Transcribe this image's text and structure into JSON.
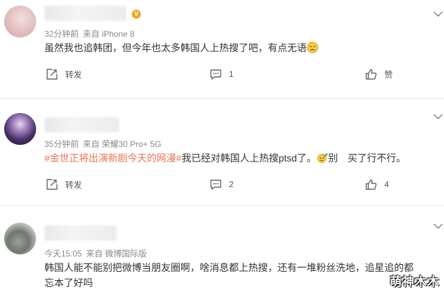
{
  "comments": [
    {
      "meta": {
        "time": "32分钟前",
        "source": "来自 iPhone 8"
      },
      "text": "虽然我也追韩团，但今年也太多韩国人上热搜了吧，有点无语",
      "emoji": "disappointed-face-emoji",
      "actions": {
        "repost_label": "转发",
        "comment_count": "1",
        "like_label": "赞"
      }
    },
    {
      "meta": {
        "time": "35分钟前",
        "source": "来自 荣耀30 Pro+ 5G"
      },
      "hashtag": "#金世正将出演新剧今天的网漫#",
      "text_a": "我已经对韩国人上热搜ptsd了。",
      "emoji": "leaf-face-emoji",
      "text_b": "别　买了行不行。",
      "actions": {
        "repost_label": "转发",
        "comment_count": "2",
        "like_count": "4"
      }
    },
    {
      "meta": {
        "time": "今天15:05",
        "source": "来自 微博国际版"
      },
      "line1": "韩国人能不能别把微博当朋友圈啊，啥消息都上热搜，还有一堆粉丝洗地，追星追的都",
      "line2": "忘本了好吗"
    }
  ],
  "watermark": "萌神木木",
  "colors": {
    "hashtag": "#eb7350",
    "meta_text": "#8a8a8a",
    "badge": "#f5a623"
  }
}
